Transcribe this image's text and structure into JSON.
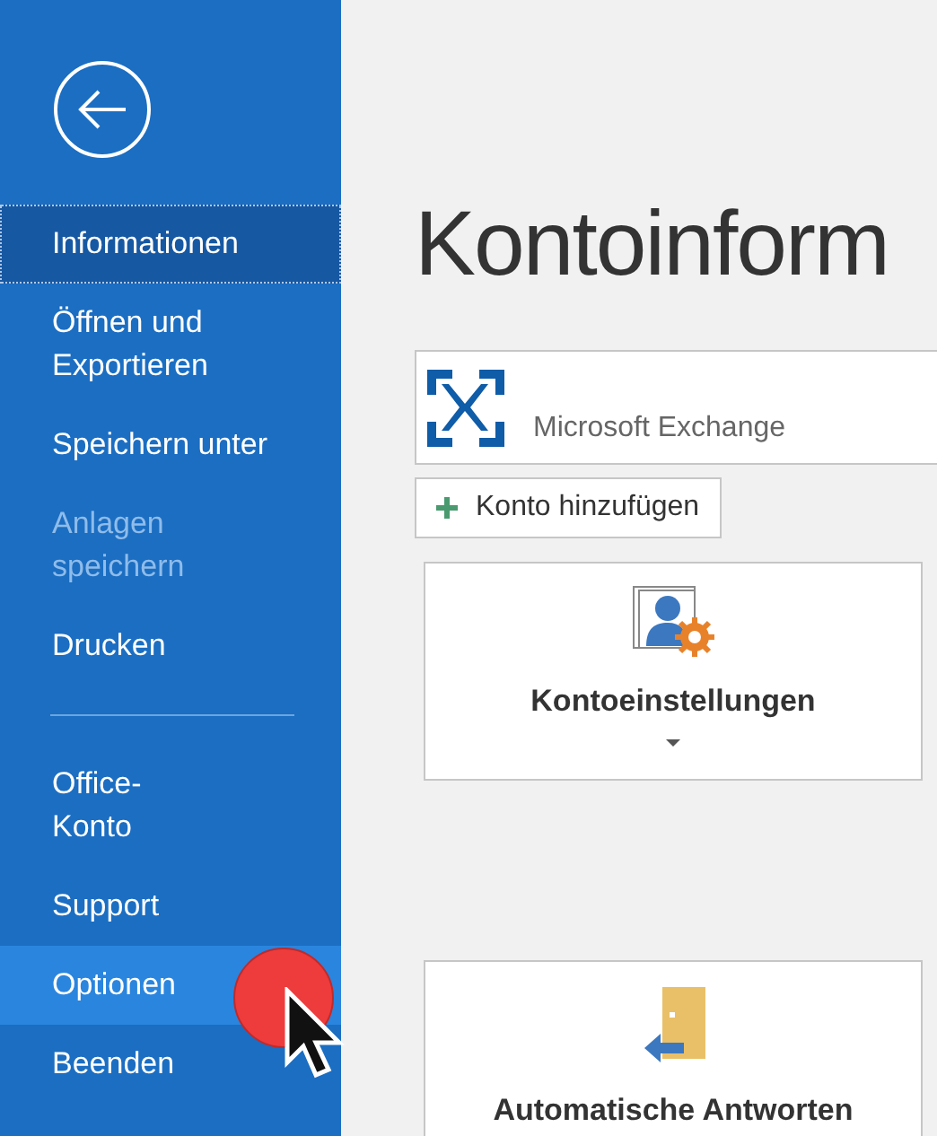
{
  "sidebar": {
    "groups": [
      [
        {
          "label": "Informationen",
          "selected": true,
          "disabled": false,
          "hovered": false
        },
        {
          "label": "Öffnen und Exportieren",
          "selected": false,
          "disabled": false,
          "hovered": false
        },
        {
          "label": "Speichern unter",
          "selected": false,
          "disabled": false,
          "hovered": false
        },
        {
          "label": "Anlagen speichern",
          "selected": false,
          "disabled": true,
          "hovered": false
        },
        {
          "label": "Drucken",
          "selected": false,
          "disabled": false,
          "hovered": false
        }
      ],
      [
        {
          "label": "Office-Konto",
          "selected": false,
          "disabled": false,
          "hovered": false
        },
        {
          "label": "Support",
          "selected": false,
          "disabled": false,
          "hovered": false
        },
        {
          "label": "Optionen",
          "selected": false,
          "disabled": false,
          "hovered": true
        },
        {
          "label": "Beenden",
          "selected": false,
          "disabled": false,
          "hovered": false
        }
      ]
    ]
  },
  "main": {
    "title": "Kontoinform",
    "account": {
      "name": "Microsoft Exchange"
    },
    "add_button": "Konto hinzufügen",
    "tiles": [
      {
        "kind": "settings",
        "label": "Kontoeinstellungen"
      },
      {
        "kind": "autoreply",
        "label": "Automatische Antworten"
      }
    ]
  }
}
